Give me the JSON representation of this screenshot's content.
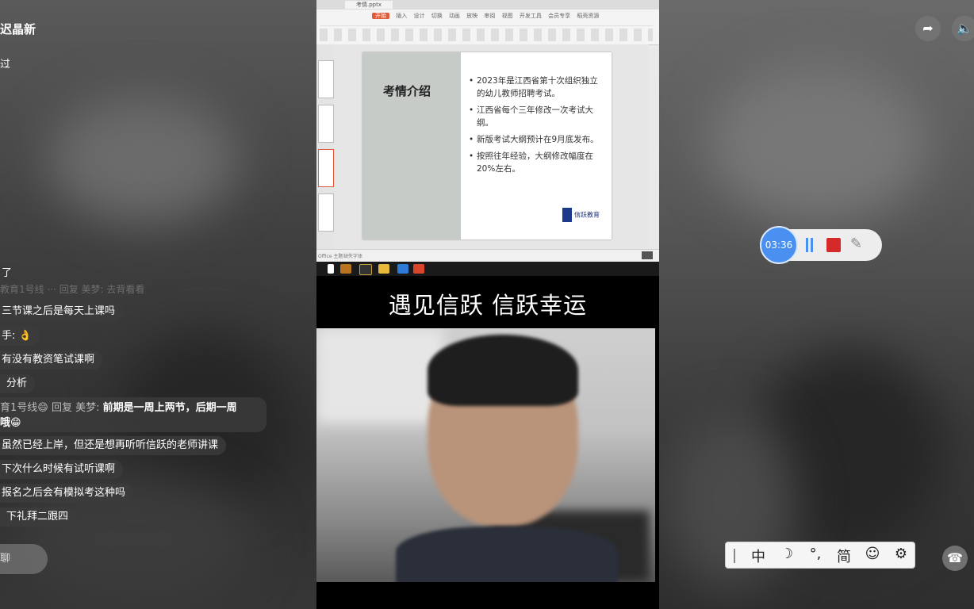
{
  "stream": {
    "host_name": "迟晶新",
    "host_sub": "过"
  },
  "chat": {
    "messages": [
      {
        "text": "了"
      },
      {
        "text": "三节课之后是每天上课吗"
      },
      {
        "text": "手: 👌"
      },
      {
        "text": "有没有教资笔试课啊"
      },
      {
        "text": "分析"
      },
      {
        "user": "育1号线😄",
        "reply_label": "回复",
        "reply_to": "美梦:",
        "text": "前期是一周上两节，后期一周",
        "text2": "哦😁"
      },
      {
        "text": "虽然已经上岸，但还是想再听听信跃的老师讲课"
      },
      {
        "text": "下次什么时候有试听课啊"
      },
      {
        "text": "报名之后会有模拟考这种吗"
      },
      {
        "text": "下礼拜二跟四"
      }
    ],
    "input_placeholder": "聊"
  },
  "ppt": {
    "filename": "考情.pptx",
    "ribbon_tabs": [
      "开始",
      "插入",
      "设计",
      "切换",
      "动画",
      "放映",
      "审阅",
      "视图",
      "开发工具",
      "会员专享",
      "稻壳资源"
    ],
    "slide": {
      "title": "考情介绍",
      "bullets": [
        "2023年是江西省第十次组织独立的幼儿教师招聘考试。",
        "江西省每个三年修改一次考试大纲。",
        "新版考试大纲预计在9月底发布。",
        "按照往年经验，大纲修改幅度在20%左右。"
      ],
      "logo_text": "信跃教育"
    },
    "status_left": "Office 主题",
    "status_font": "缺失字体"
  },
  "banner": "遇见信跃  信跃幸运",
  "recorder": {
    "time": "03:36",
    "colors": {
      "timer": "#4a90f0",
      "stop": "#d42a2a"
    }
  },
  "ime": {
    "items": [
      "中",
      "☽",
      "°,",
      "简",
      "☺",
      "⚙"
    ]
  },
  "icons": {
    "share": "share-icon",
    "volume": "volume-icon",
    "phone": "phone-icon"
  }
}
